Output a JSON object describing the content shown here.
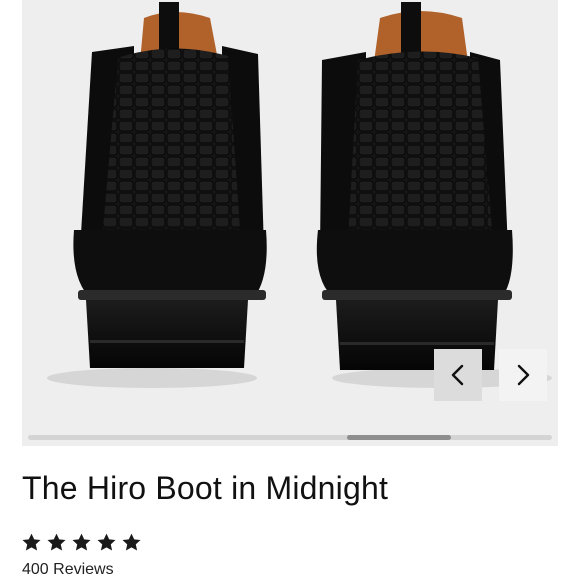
{
  "product": {
    "title": "The Hiro Boot in Midnight",
    "rating": 5,
    "rating_max": 5,
    "reviews_label": "400 Reviews"
  },
  "gallery": {
    "image_subject": "boot-photo",
    "scroll_position": 0.76,
    "scroll_visible_fraction": 0.2,
    "prev_icon": "chevron-left-icon",
    "next_icon": "chevron-right-icon"
  },
  "colors": {
    "gallery_bg": "#eeeeef",
    "boot": "#111111",
    "lining": "#b0622a",
    "star": "#1a1a1a",
    "text": "#111111"
  }
}
